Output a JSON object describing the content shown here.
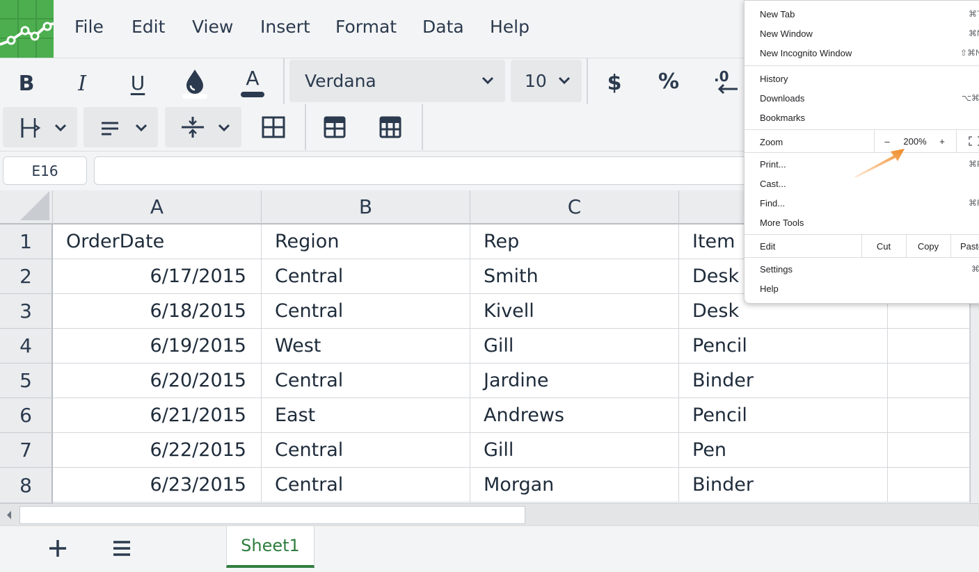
{
  "menubar": {
    "items": [
      "File",
      "Edit",
      "View",
      "Insert",
      "Format",
      "Data",
      "Help"
    ]
  },
  "toolbar": {
    "bold_label": "B",
    "italic_label": "I",
    "underline_label": "U",
    "text_color_label": "A",
    "font_name": "Verdana",
    "font_size": "10",
    "currency_label": "$",
    "percent_label": "%",
    "decimal_label": ".0"
  },
  "formula_bar": {
    "cell_ref": "E16",
    "formula": ""
  },
  "grid": {
    "columns": [
      "A",
      "B",
      "C",
      ""
    ],
    "rows": [
      "1",
      "2",
      "3",
      "4",
      "5",
      "6",
      "7",
      "8"
    ],
    "header_row": [
      "OrderDate",
      "Region",
      "Rep",
      "Item"
    ],
    "data": [
      [
        "6/17/2015",
        "Central",
        "Smith",
        "Desk"
      ],
      [
        "6/18/2015",
        "Central",
        "Kivell",
        "Desk"
      ],
      [
        "6/19/2015",
        "West",
        "Gill",
        "Pencil"
      ],
      [
        "6/20/2015",
        "Central",
        "Jardine",
        "Binder"
      ],
      [
        "6/21/2015",
        "East",
        "Andrews",
        "Pencil"
      ],
      [
        "6/22/2015",
        "Central",
        "Gill",
        "Pen"
      ],
      [
        "6/23/2015",
        "Central",
        "Morgan",
        "Binder"
      ]
    ]
  },
  "bottombar": {
    "sheet_tab": "Sheet1"
  },
  "browser_menu": {
    "new_tab": "New Tab",
    "new_tab_short": "⌘T",
    "new_window": "New Window",
    "new_window_short": "⌘N",
    "incognito": "New Incognito Window",
    "incognito_short": "⇧⌘N",
    "history": "History",
    "downloads": "Downloads",
    "downloads_short": "⌥⌘L",
    "bookmarks": "Bookmarks",
    "zoom_label": "Zoom",
    "zoom_minus": "–",
    "zoom_value": "200%",
    "zoom_plus": "+",
    "print": "Print...",
    "print_short": "⌘P",
    "cast": "Cast...",
    "find": "Find...",
    "find_short": "⌘F",
    "more_tools": "More Tools",
    "edit_label": "Edit",
    "cut": "Cut",
    "copy": "Copy",
    "paste": "Paste",
    "settings": "Settings",
    "settings_short": "⌘,",
    "help": "Help"
  },
  "colors": {
    "brand_green": "#4cae4f",
    "sheet_tab_green": "#2f7d3e",
    "annotation_arrow": "#f08a24"
  }
}
